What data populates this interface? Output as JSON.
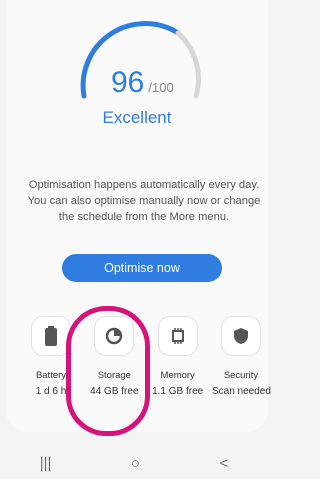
{
  "score": {
    "value": "96",
    "max": "/100",
    "rating": "Excellent"
  },
  "description": "Optimisation happens automatically every day. You can also optimise manually now or change the schedule from the More menu.",
  "optimise_button": "Optimise now",
  "tiles": [
    {
      "name": "Battery",
      "value": "1 d 6 h",
      "icon": "battery-icon"
    },
    {
      "name": "Storage",
      "value": "44 GB free",
      "icon": "storage-pie-icon"
    },
    {
      "name": "Memory",
      "value": "1.1 GB free",
      "icon": "memory-chip-icon"
    },
    {
      "name": "Security",
      "value": "Scan needed",
      "icon": "shield-icon"
    }
  ],
  "nav": {
    "recents": "|||",
    "home": "○",
    "back": "<"
  },
  "colors": {
    "accent": "#2f7de1",
    "highlight": "#d6137a"
  }
}
